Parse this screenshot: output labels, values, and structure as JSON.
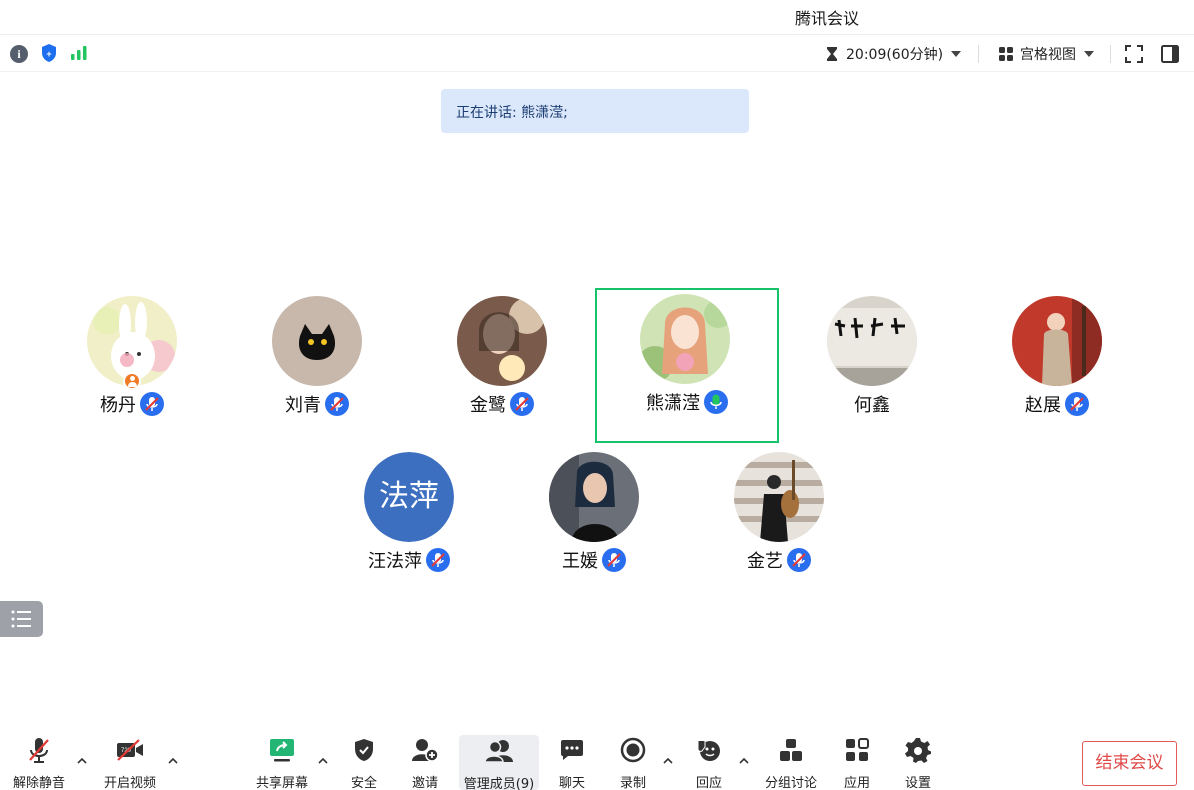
{
  "window": {
    "title": "腾讯会议"
  },
  "status_bar": {
    "timer": "20:09(60分钟)",
    "view_mode": "宫格视图"
  },
  "speaking": {
    "label": "正在讲话:",
    "speakers": "熊潇滢;"
  },
  "participants": [
    {
      "name": "杨丹",
      "avatar": "bunny-avatar",
      "mic": "muted",
      "host": true
    },
    {
      "name": "刘青",
      "avatar": "black-cat-avatar",
      "mic": "muted"
    },
    {
      "name": "金鹭",
      "avatar": "photo-avatar",
      "mic": "muted"
    },
    {
      "name": "熊潇滢",
      "avatar": "illustration-avatar",
      "mic": "speaking",
      "active": true
    },
    {
      "name": "何鑫",
      "avatar": "calligraphy-avatar",
      "mic": "none"
    },
    {
      "name": "赵展",
      "avatar": "photo-avatar",
      "mic": "muted"
    },
    {
      "name": "汪法萍",
      "avatar_text": "法萍",
      "mic": "muted"
    },
    {
      "name": "王媛",
      "avatar": "photo-avatar",
      "mic": "muted"
    },
    {
      "name": "金艺",
      "avatar": "photo-avatar",
      "mic": "muted"
    }
  ],
  "toolbar": {
    "unmute": "解除静音",
    "start_video": "开启视频",
    "share_screen": "共享屏幕",
    "security": "安全",
    "invite": "邀请",
    "manage_members": "管理成员(9)",
    "chat": "聊天",
    "record": "录制",
    "reactions": "回应",
    "breakout": "分组讨论",
    "apps": "应用",
    "settings": "设置",
    "end_meeting": "结束会议"
  },
  "colors": {
    "active_border": "#16c26a",
    "speaking_bg": "#dbe8fb",
    "end_red": "#e04848",
    "mic_blue": "#2a6ef0"
  }
}
